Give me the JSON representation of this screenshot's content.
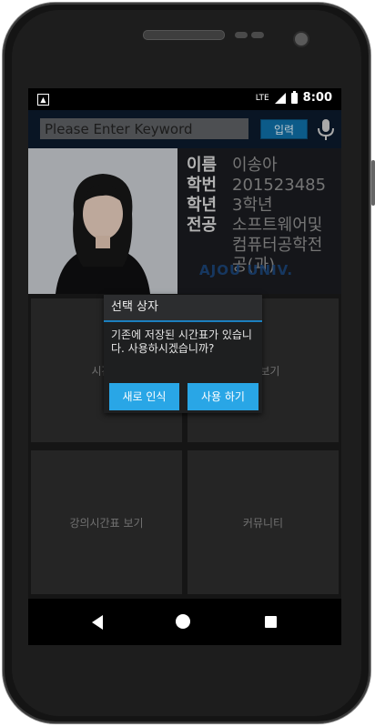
{
  "status_bar": {
    "network": "LTE",
    "time": "8:00"
  },
  "search": {
    "placeholder": "Please Enter Keyword",
    "value": "",
    "button_label": "입력"
  },
  "profile": {
    "rows": [
      {
        "label": "이름",
        "value": "이송아"
      },
      {
        "label": "학번",
        "value": "201523485"
      },
      {
        "label": "학년",
        "value": "3학년"
      },
      {
        "label": "전공",
        "value": "소프트웨어및 컴퓨터공학전공(과)"
      }
    ],
    "watermark": "AJOU UNIV."
  },
  "tiles": {
    "top_left": "시간표",
    "top_right": "목 보기",
    "bottom_left": "강의시간표 보기",
    "bottom_right": "커뮤니티"
  },
  "dialog": {
    "title": "선택 상자",
    "message": "기존에 저장된 시간표가 있습니다. 사용하시겠습니까?",
    "button_new": "새로 인식",
    "button_use": "사용 하기"
  },
  "colors": {
    "accent": "#29a6e6",
    "search_bar": "#0c1a2d"
  }
}
